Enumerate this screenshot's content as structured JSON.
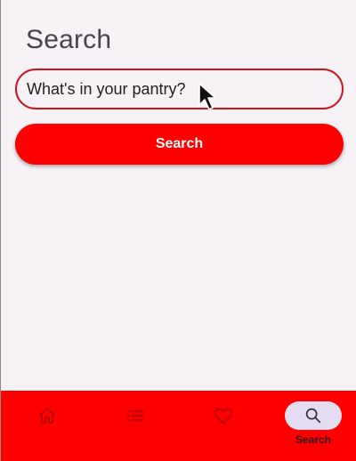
{
  "page": {
    "title": "Search"
  },
  "search": {
    "placeholder": "What's in your pantry?",
    "value": ""
  },
  "search_button": {
    "label": "Search"
  },
  "bottom_nav": {
    "items": [
      {
        "icon": "home-icon",
        "label": "",
        "active": false
      },
      {
        "icon": "list-icon",
        "label": "",
        "active": false
      },
      {
        "icon": "heart-icon",
        "label": "",
        "active": false
      },
      {
        "icon": "search-icon",
        "label": "Search",
        "active": true
      }
    ]
  },
  "colors": {
    "accent": "#ff0000",
    "field_border": "#c9141f",
    "background": "#f6f2f6",
    "active_pill": "#e4ddf1"
  }
}
